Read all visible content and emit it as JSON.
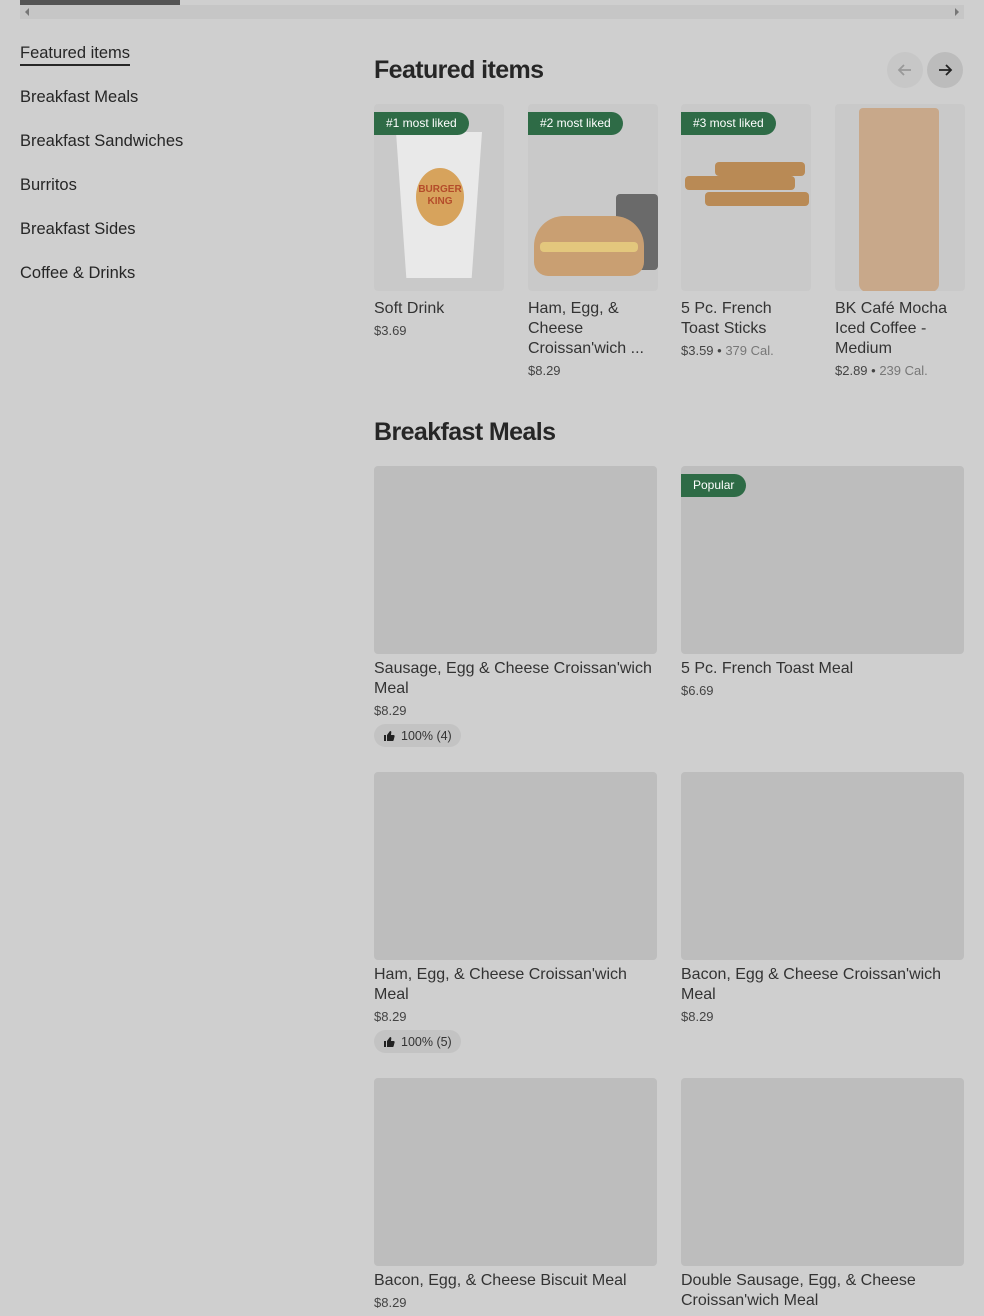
{
  "sidebar": {
    "items": [
      {
        "label": "Featured items",
        "active": true
      },
      {
        "label": "Breakfast Meals"
      },
      {
        "label": "Breakfast Sandwiches"
      },
      {
        "label": "Burritos"
      },
      {
        "label": "Breakfast Sides"
      },
      {
        "label": "Coffee & Drinks"
      }
    ]
  },
  "featured": {
    "title": "Featured items",
    "prev_icon": "arrow-left-icon",
    "next_icon": "arrow-right-icon",
    "items": [
      {
        "badge": "#1 most liked",
        "name": "Soft Drink",
        "price": "$3.69",
        "cal": ""
      },
      {
        "badge": "#2 most liked",
        "name": "Ham, Egg, & Cheese Croissan'wich ...",
        "price": "$8.29",
        "cal": ""
      },
      {
        "badge": "#3 most liked",
        "name": "5 Pc. French Toast Sticks",
        "price": "$3.59",
        "cal": "379 Cal."
      },
      {
        "badge": "",
        "name": "BK Café Mocha Iced Coffee - Medium",
        "price": "$2.89",
        "cal": "239 Cal."
      }
    ]
  },
  "breakfast_meals": {
    "title": "Breakfast Meals",
    "items": [
      {
        "name": "Sausage, Egg & Cheese Croissan'wich Meal",
        "price": "$8.29",
        "rating": "100% (4)",
        "badge": ""
      },
      {
        "name": "5 Pc. French Toast Meal",
        "price": "$6.69",
        "rating": "",
        "badge": "Popular"
      },
      {
        "name": "Ham, Egg, & Cheese Croissan'wich Meal",
        "price": "$8.29",
        "rating": "100% (5)",
        "badge": ""
      },
      {
        "name": "Bacon, Egg & Cheese Croissan'wich Meal",
        "price": "$8.29",
        "rating": "",
        "badge": ""
      },
      {
        "name": "Bacon, Egg, & Cheese Biscuit Meal",
        "price": "$8.29",
        "rating": "",
        "badge": ""
      },
      {
        "name": "Double Sausage, Egg, & Cheese Croissan'wich Meal",
        "price": "",
        "rating": "",
        "badge": ""
      }
    ]
  },
  "logo_text": "BURGER KING",
  "colors": {
    "badge_green": "#2e6b46",
    "overlay_bg": "#cfcfcf"
  }
}
